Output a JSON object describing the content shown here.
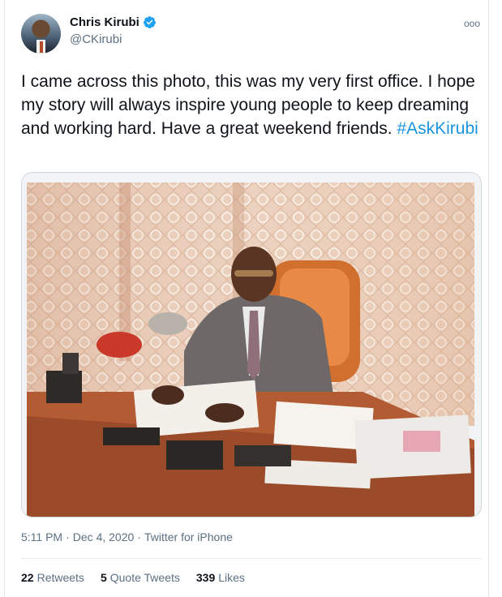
{
  "author": {
    "name": "Chris Kirubi",
    "handle": "@CKirubi"
  },
  "icons": {
    "verified": "verified-badge-icon",
    "more": "more-options-icon",
    "more_glyph": "ooo"
  },
  "tweet": {
    "text": "I came across this photo, this was my very first office. I hope my story will always inspire young people to keep dreaming and working hard. Have a great weekend friends. ",
    "hashtag": "#AskKirubi"
  },
  "meta": {
    "time": "5:11 PM",
    "separator1": "·",
    "date": "Dec 4, 2020",
    "separator2": "·",
    "source": "Twitter for iPhone"
  },
  "stats": {
    "retweets_count": "22",
    "retweets_label": "Retweets",
    "quotes_count": "5",
    "quotes_label": "Quote Tweets",
    "likes_count": "339",
    "likes_label": "Likes"
  },
  "colors": {
    "link": "#1b95e0",
    "verified": "#1da1f2",
    "secondary_text": "#5b7083"
  }
}
